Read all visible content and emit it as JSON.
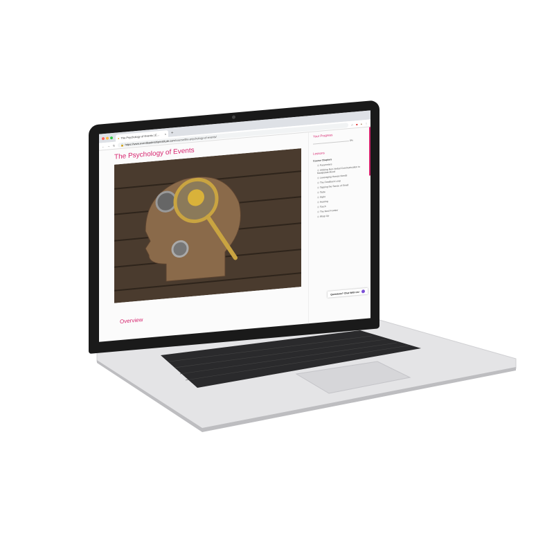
{
  "browser": {
    "tab_title": "The Psychology of Events | E...",
    "new_tab": "+",
    "url_host": "https://www.eventleadershipinstitute.com",
    "url_path": "/course/the-psychology-of-events/"
  },
  "page": {
    "title": "The Psychology of Events",
    "hero_image": "head silhouette with gears and magnifying glass on wood",
    "overview": "Overview"
  },
  "sidebar": {
    "progress_heading": "Your Progress",
    "progress_percent": 0,
    "progress_label": "0%",
    "lessons_heading": "Lessons",
    "chapters_label": "Course Chapters",
    "items": [
      "Parameters",
      "Utilizing Non-Verbal Communication to Manipulate Mood",
      "Leveraging Human Needs",
      "The Feedback Loop",
      "Tapping the Sense of Smell",
      "Taste",
      "Sight",
      "Hearing",
      "Touch",
      "The Next Frontier",
      "Wrap Up"
    ]
  },
  "chat": {
    "label": "Questions? Chat With Us!"
  },
  "colors": {
    "accent": "#d6246e",
    "chat": "#7b4fd6"
  }
}
